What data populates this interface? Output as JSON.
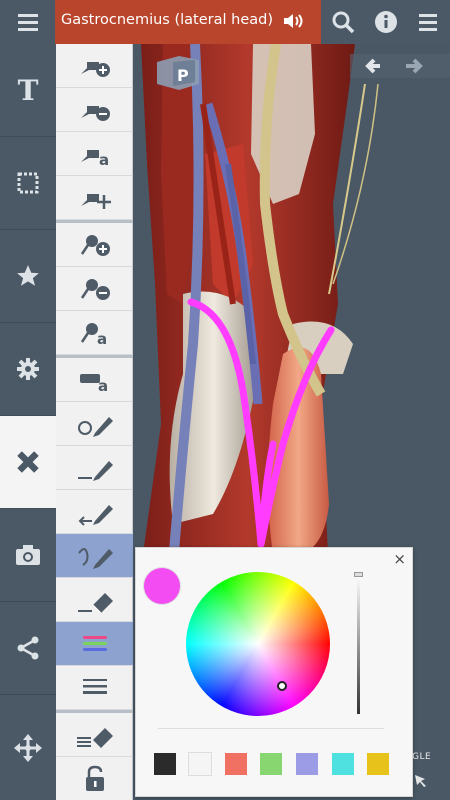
{
  "header": {
    "title": "Gastrocnemius (lateral head)",
    "title_bg": "#b9452c"
  },
  "top_icons": [
    "menu-icon",
    "speaker-icon",
    "search-icon",
    "info-icon",
    "overflow-menu-icon"
  ],
  "left_nav": {
    "items": [
      {
        "name": "text",
        "icon": "text-icon",
        "glyph": "T"
      },
      {
        "name": "select",
        "icon": "selection-frame-icon"
      },
      {
        "name": "favorites",
        "icon": "star-icon"
      },
      {
        "name": "settings",
        "icon": "gear-icon"
      },
      {
        "name": "draw",
        "icon": "pencil-ruler-icon",
        "active": true
      },
      {
        "name": "camera",
        "icon": "camera-icon"
      },
      {
        "name": "share",
        "icon": "share-icon"
      },
      {
        "name": "move",
        "icon": "move-arrows-icon"
      }
    ]
  },
  "tools": {
    "label_glyph": "a",
    "selected": [
      "freehand-pen",
      "line-colors"
    ]
  },
  "cube_label": "P",
  "color_panel": {
    "close": "×",
    "current_color": "#f24cf2",
    "swatches": [
      "#2b2b2b",
      "#f5f5f5",
      "#f07062",
      "#87d66f",
      "#9c9ce6",
      "#4fe0e0",
      "#e6c21a"
    ]
  },
  "corner_label": "GLE"
}
